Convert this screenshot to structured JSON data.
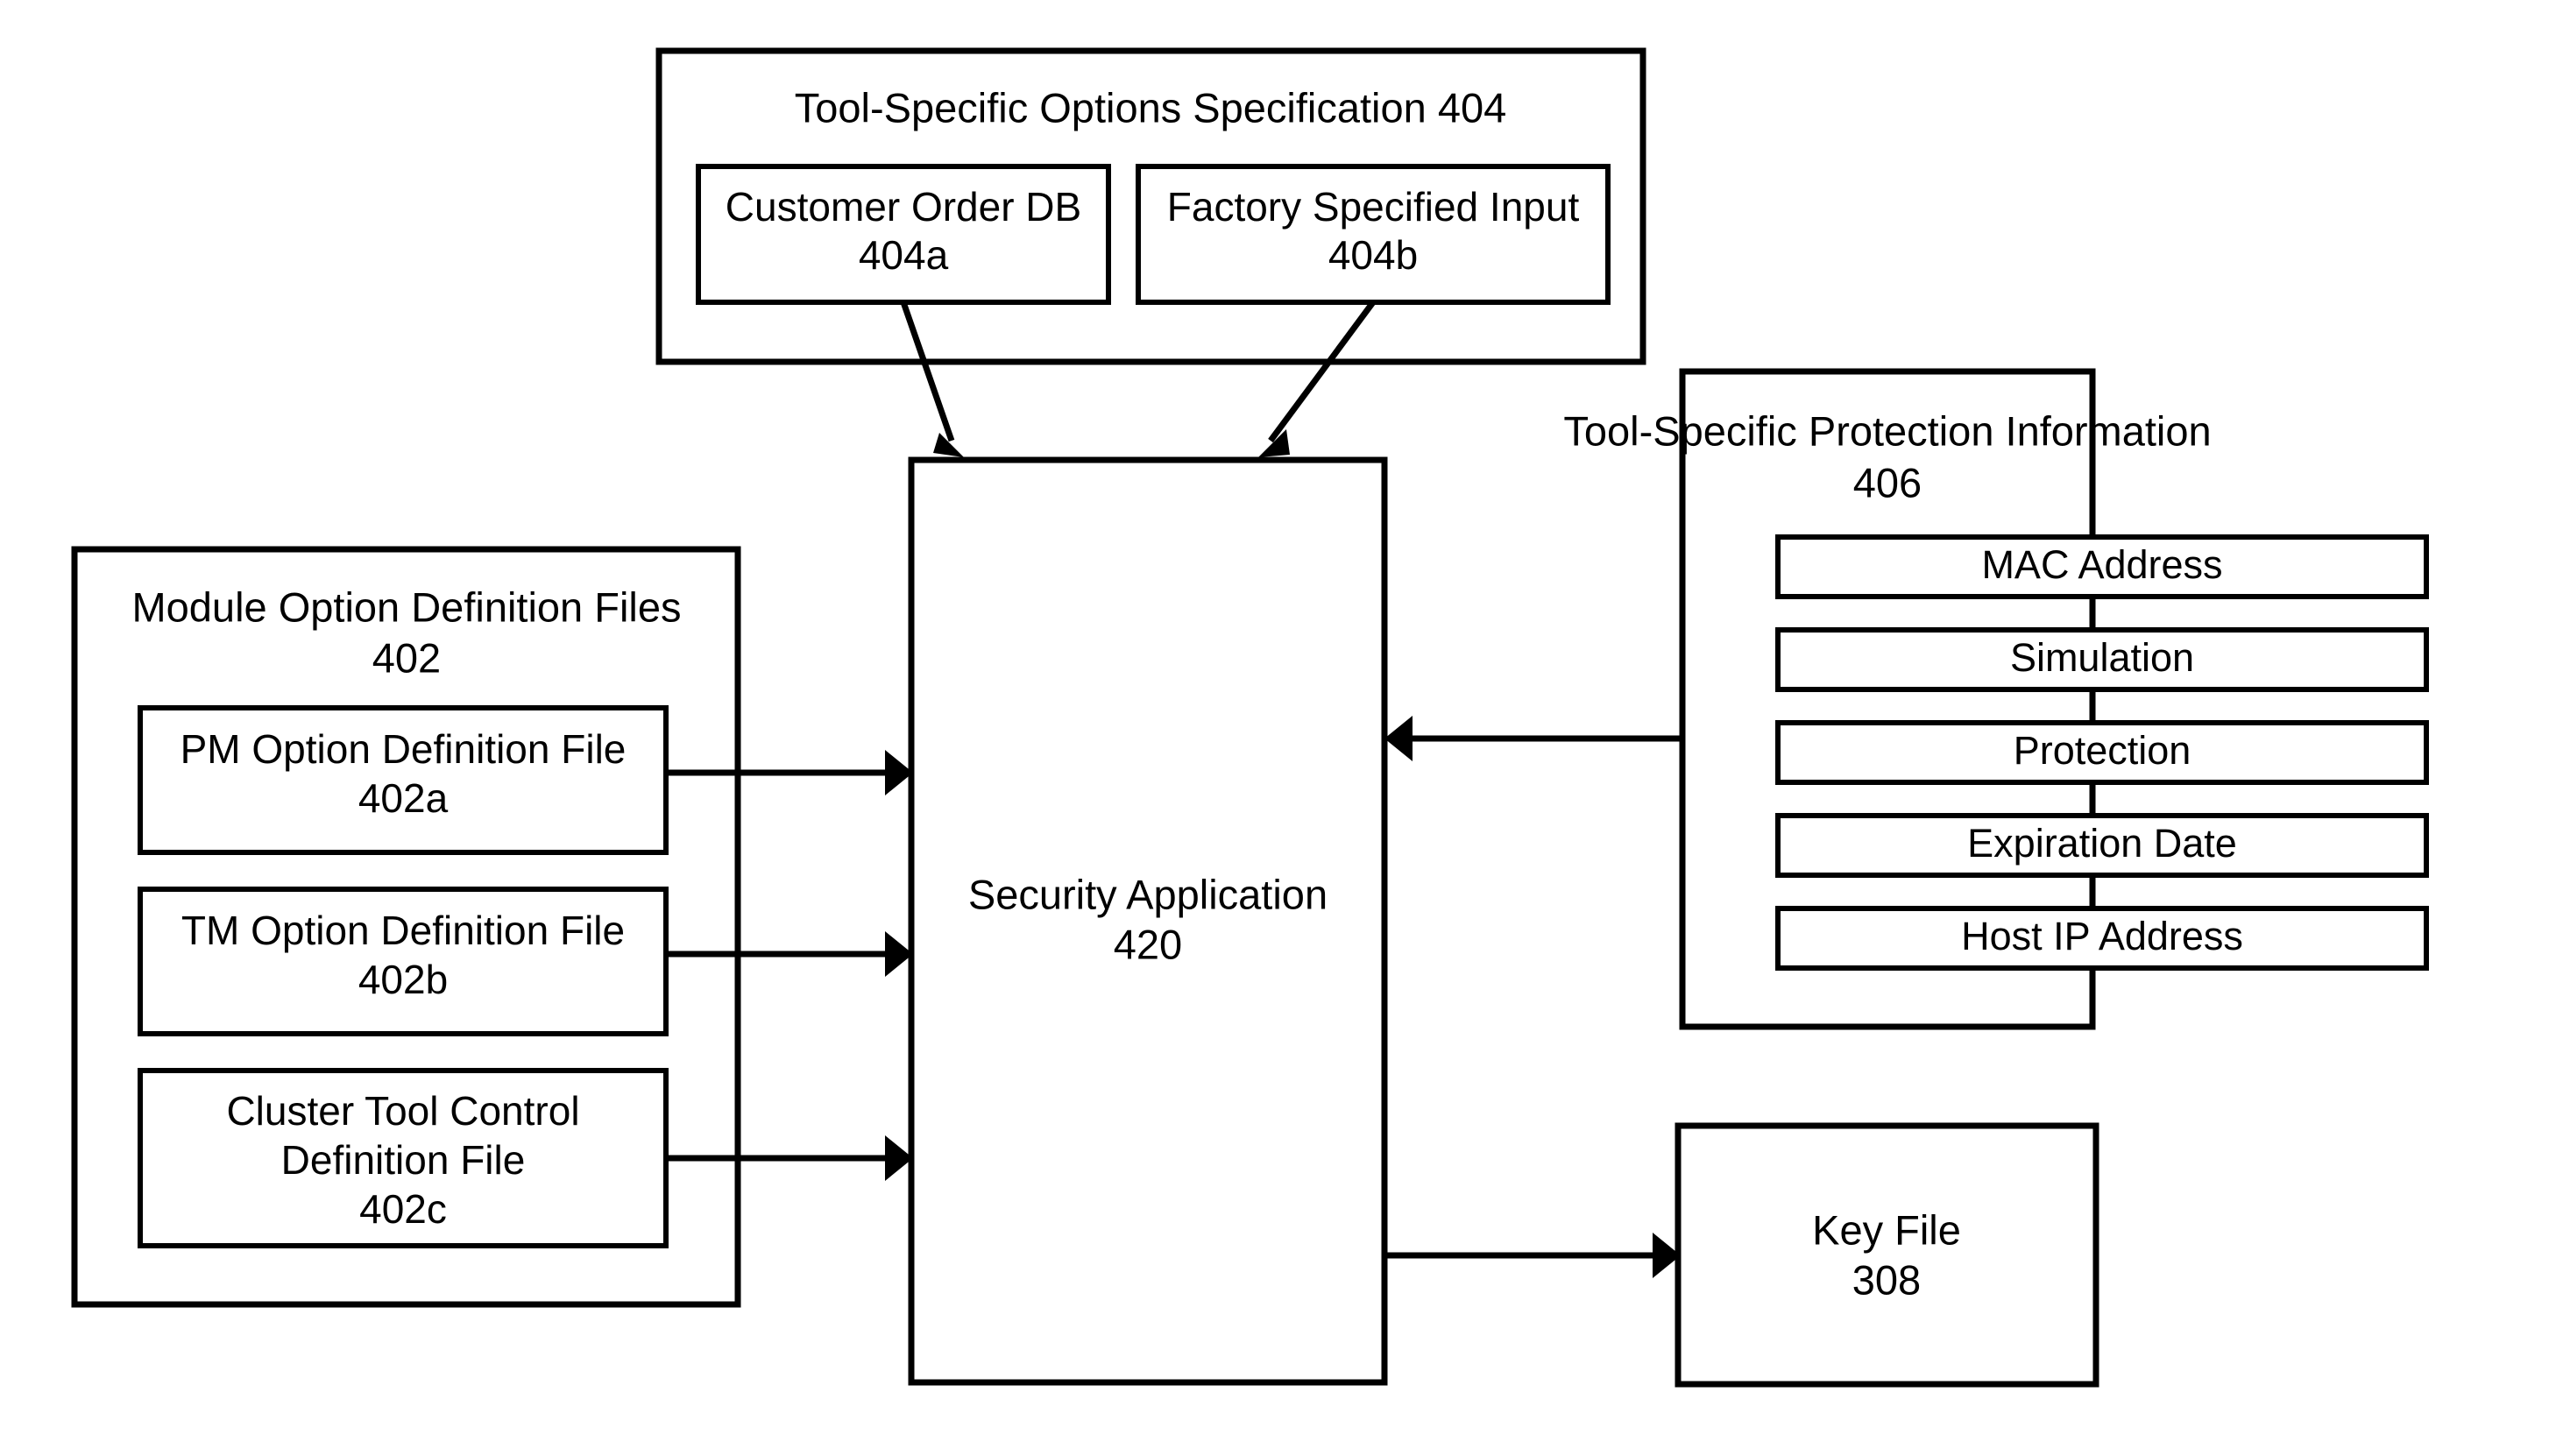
{
  "figure": {
    "background_color": "#ffffff",
    "line_color": "#000000"
  },
  "options_spec": {
    "title": "Tool-Specific Options Specification 404",
    "children": [
      {
        "label": "Customer Order DB",
        "ref": "404a"
      },
      {
        "label": "Factory Specified Input",
        "ref": "404b"
      }
    ]
  },
  "module_files": {
    "title_line1": "Module Option Definition Files",
    "title_line2": "402",
    "children": [
      {
        "line1": "PM Option Definition File",
        "line2": "",
        "ref": "402a"
      },
      {
        "line1": "TM Option Definition File",
        "line2": "",
        "ref": "402b"
      },
      {
        "line1": "Cluster Tool Control",
        "line2": "Definition File",
        "ref": "402c"
      }
    ]
  },
  "security_application": {
    "label": "Security Application",
    "ref": "420"
  },
  "protection_info": {
    "title_line1": "Tool-Specific Protection Information",
    "title_line2": "406",
    "items": [
      "MAC Address",
      "Simulation",
      "Protection",
      "Expiration Date",
      "Host IP Address"
    ]
  },
  "key_file": {
    "label": "Key File",
    "ref": "308"
  }
}
